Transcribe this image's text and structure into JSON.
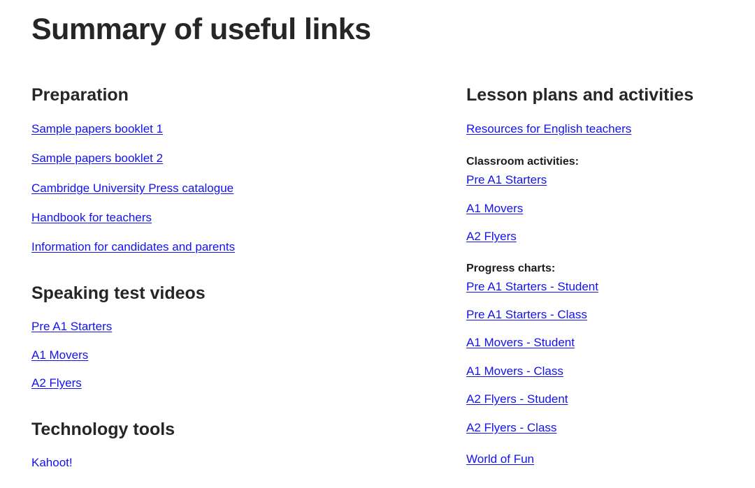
{
  "page": {
    "title": "Summary of useful links",
    "background_color": "#ffffff",
    "link_color": "#1212ee",
    "heading_color": "#262626"
  },
  "columns": {
    "left": {
      "sections": [
        {
          "heading": "Preparation",
          "links": [
            "Sample papers booklet 1",
            "Sample papers booklet 2",
            "Cambridge University Press catalogue",
            "Handbook for teachers",
            "Information for candidates and parents"
          ]
        },
        {
          "heading": "Speaking test videos",
          "links": [
            "Pre A1 Starters",
            "A1 Movers",
            "A2 Flyers"
          ]
        },
        {
          "heading": "Technology tools",
          "links": [
            "Kahoot!"
          ]
        }
      ]
    },
    "right": {
      "heading": "Lesson plans and activities",
      "intro_links": [
        "Resources for English teachers"
      ],
      "groups": [
        {
          "label": "Classroom activities:",
          "links": [
            "Pre A1 Starters",
            "A1 Movers",
            "A2 Flyers"
          ]
        },
        {
          "label": "Progress charts:",
          "links": [
            "Pre A1 Starters - Student",
            "Pre A1 Starters - Class",
            "A1 Movers - Student",
            "A1 Movers - Class",
            "A2 Flyers - Student",
            "A2 Flyers - Class"
          ]
        }
      ],
      "extra_links": [
        "World of Fun"
      ]
    }
  }
}
